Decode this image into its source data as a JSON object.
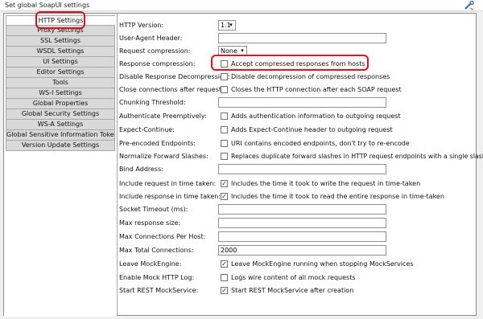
{
  "window": {
    "title": "Set global SoapUI settings",
    "settings_icon": "tool-icon"
  },
  "sidebar": {
    "tabs": [
      {
        "label": "HTTP Settings",
        "selected": true
      },
      {
        "label": "Proxy Settings"
      },
      {
        "label": "SSL Settings"
      },
      {
        "label": "WSDL Settings"
      },
      {
        "label": "UI Settings"
      },
      {
        "label": "Editor Settings"
      },
      {
        "label": "Tools"
      },
      {
        "label": "WS-I Settings"
      },
      {
        "label": "Global Properties"
      },
      {
        "label": "Global Security Settings"
      },
      {
        "label": "WS-A Settings"
      },
      {
        "label": "Global Sensitive Information Tokens"
      },
      {
        "label": "Version Update Settings"
      }
    ]
  },
  "settings": {
    "http_version": {
      "label": "HTTP Version:",
      "value": "1.1"
    },
    "user_agent": {
      "label": "User-Agent Header:",
      "value": ""
    },
    "request_compression": {
      "label": "Request compression:",
      "value": "None"
    },
    "response_compression": {
      "label": "Response compression:",
      "checked": false,
      "text": "Accept compressed responses from hosts"
    },
    "disable_decompression": {
      "label": "Disable Response Decompression:",
      "checked": false,
      "text": "Disable decompression of compressed responses"
    },
    "close_connections": {
      "label": "Close connections after request:",
      "checked": false,
      "text": "Closes the HTTP connection after each SOAP request"
    },
    "chunking_threshold": {
      "label": "Chunking Threshold:",
      "value": ""
    },
    "authenticate_preemptively": {
      "label": "Authenticate Preemptively:",
      "checked": false,
      "text": "Adds authentication information to outgoing request"
    },
    "expect_continue": {
      "label": "Expect-Continue:",
      "checked": false,
      "text": "Adds Expect-Continue header to outgoing request"
    },
    "pre_encoded": {
      "label": "Pre-encoded Endpoints:",
      "checked": false,
      "text": "URI contains encoded endpoints, don't try to re-encode"
    },
    "normalize_slashes": {
      "label": "Normalize Forward Slashes:",
      "checked": false,
      "text": "Replaces duplicate forward slashes in HTTP request endpoints with a single slash"
    },
    "bind_address": {
      "label": "Bind Address:",
      "value": ""
    },
    "include_request_time": {
      "label": "Include request in time taken:",
      "checked": true,
      "text": "Includes the time it took to write the request in time-taken"
    },
    "include_response_time": {
      "label": "Include response in time taken:",
      "checked": true,
      "text": "Includes the time it took to read the entire response in time-taken"
    },
    "socket_timeout": {
      "label": "Socket Timeout (ms):",
      "value": ""
    },
    "max_response_size": {
      "label": "Max response size:",
      "value": ""
    },
    "max_connections_per_host": {
      "label": "Max Connections Per Host:",
      "value": ""
    },
    "max_total_connections": {
      "label": "Max Total Connections:",
      "value": "2000"
    },
    "leave_mockengine": {
      "label": "Leave MockEngine:",
      "checked": true,
      "text": "Leave MockEngine running when stopping MockServices"
    },
    "enable_mock_http_log": {
      "label": "Enable Mock HTTP Log:",
      "checked": false,
      "text": "Logs wire content of all mock requests"
    },
    "start_rest_mockservice": {
      "label": "Start REST MockService:",
      "checked": true,
      "text": "Start REST MockService after creation"
    }
  },
  "annotations": {
    "highlight_color": "#e0101a"
  }
}
